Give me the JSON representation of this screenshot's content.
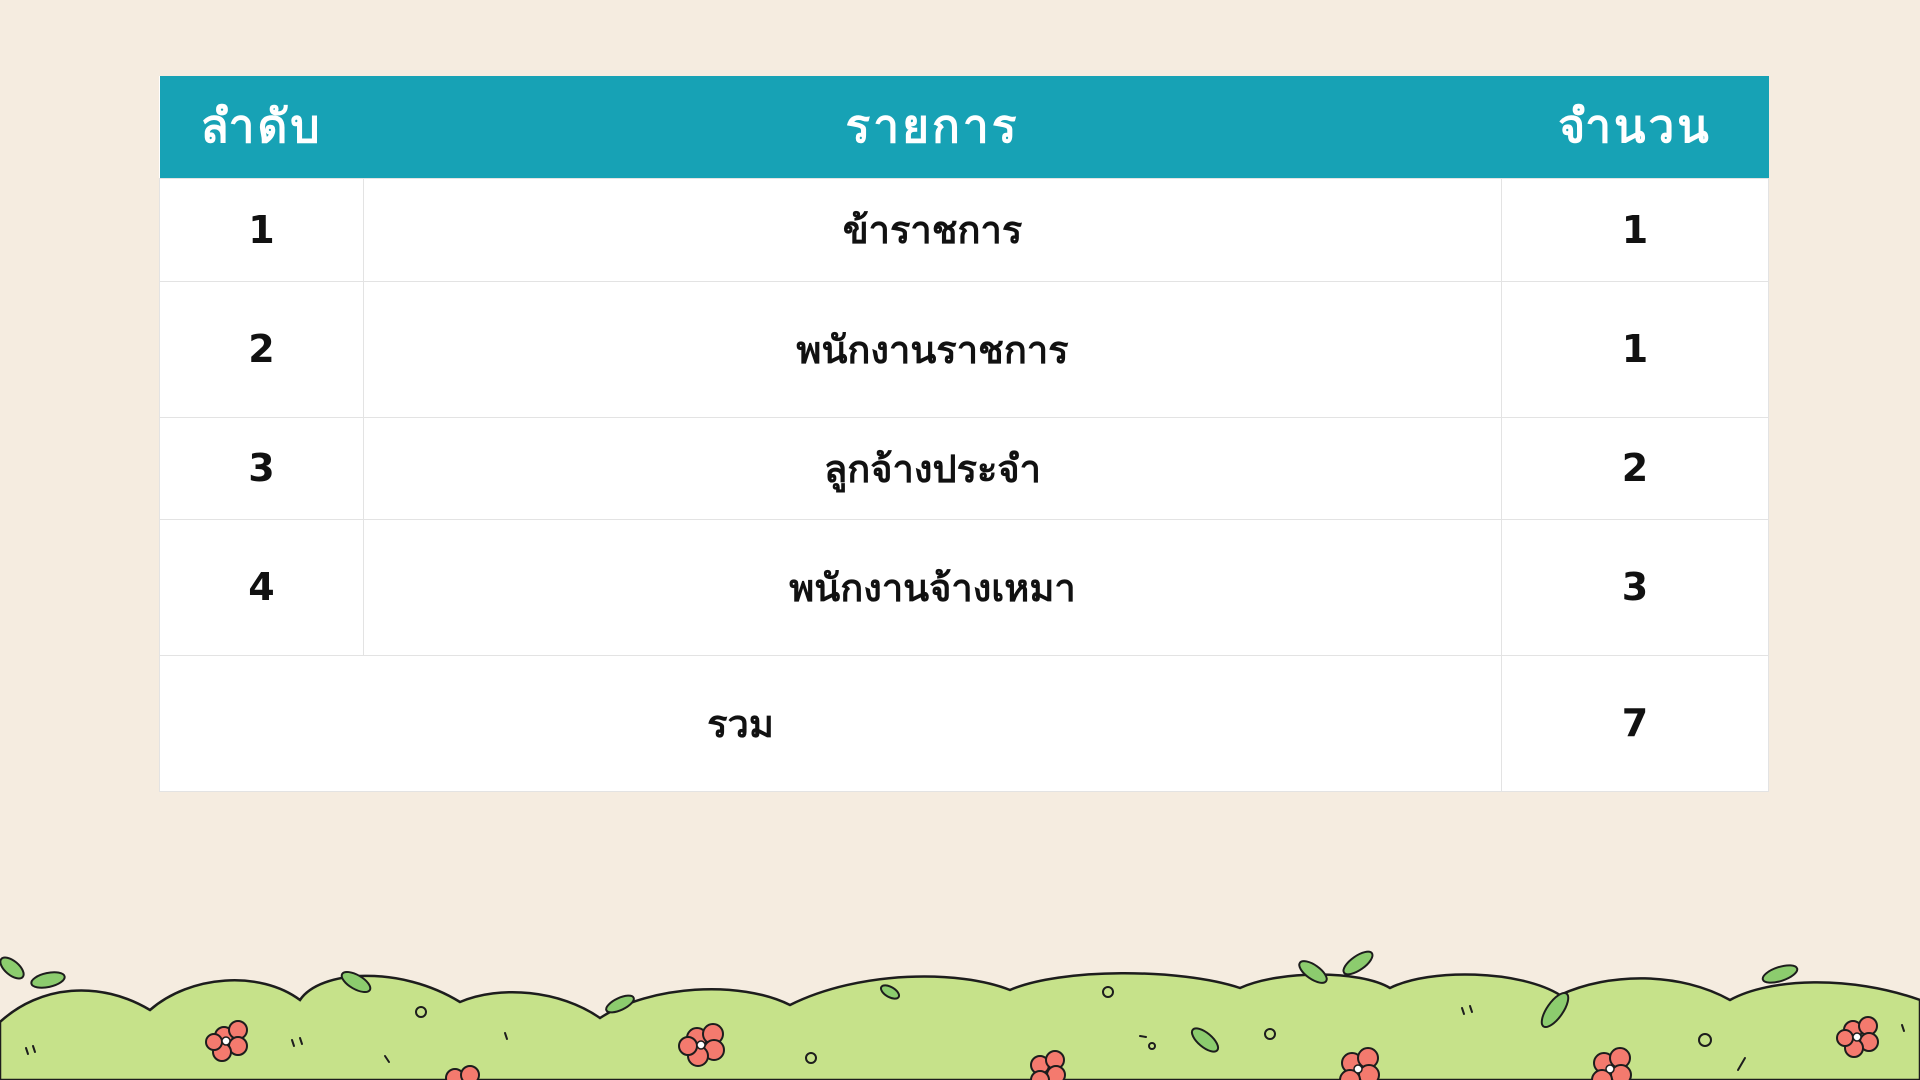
{
  "table": {
    "headers": [
      "ลำดับ",
      "รายการ",
      "จำนวน"
    ],
    "rows": [
      {
        "no": "1",
        "item": "ข้าราชการ",
        "qty": "1"
      },
      {
        "no": "2",
        "item": "พนักงานราชการ",
        "qty": "1"
      },
      {
        "no": "3",
        "item": "ลูกจ้างประจำ",
        "qty": "2"
      },
      {
        "no": "4",
        "item": "พนักงานจ้างเหมา",
        "qty": "3"
      }
    ],
    "total": {
      "label": "รวม",
      "qty": "7"
    }
  },
  "colors": {
    "background": "#f5ece0",
    "header": "#17a2b5",
    "bush": "#c6e28a",
    "flower": "#f47a6e"
  }
}
